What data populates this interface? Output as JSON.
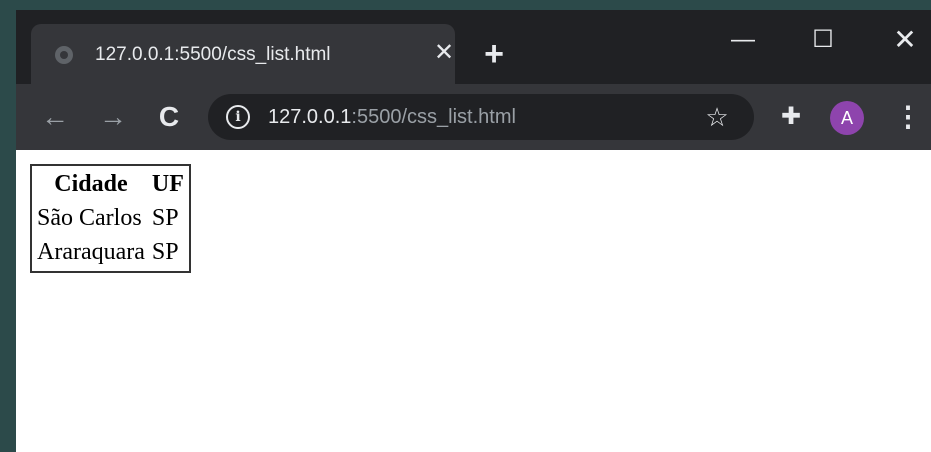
{
  "tab": {
    "title": "127.0.0.1:5500/css_list.html",
    "close_glyph": "✕",
    "favicon_icon": "globe-icon"
  },
  "new_tab_glyph": "+",
  "window_controls": {
    "minimize": "—",
    "maximize": "☐",
    "close": "✕"
  },
  "toolbar": {
    "back_glyph": "←",
    "forward_glyph": "→",
    "reload_glyph": "C",
    "url_host": "127.0.0.1",
    "url_rest": ":5500/css_list.html",
    "info_glyph": "i",
    "star_glyph": "☆",
    "extensions_glyph": "✚",
    "avatar_letter": "A",
    "menu_glyph": "⋮"
  },
  "table": {
    "headers": [
      "Cidade",
      "UF"
    ],
    "rows": [
      [
        "São Carlos",
        "SP"
      ],
      [
        "Araraquara",
        "SP"
      ]
    ]
  },
  "colors": {
    "frame": "#202124",
    "toolbar": "#35363a",
    "avatar": "#8e44ad",
    "background": "#2c4a4a"
  }
}
